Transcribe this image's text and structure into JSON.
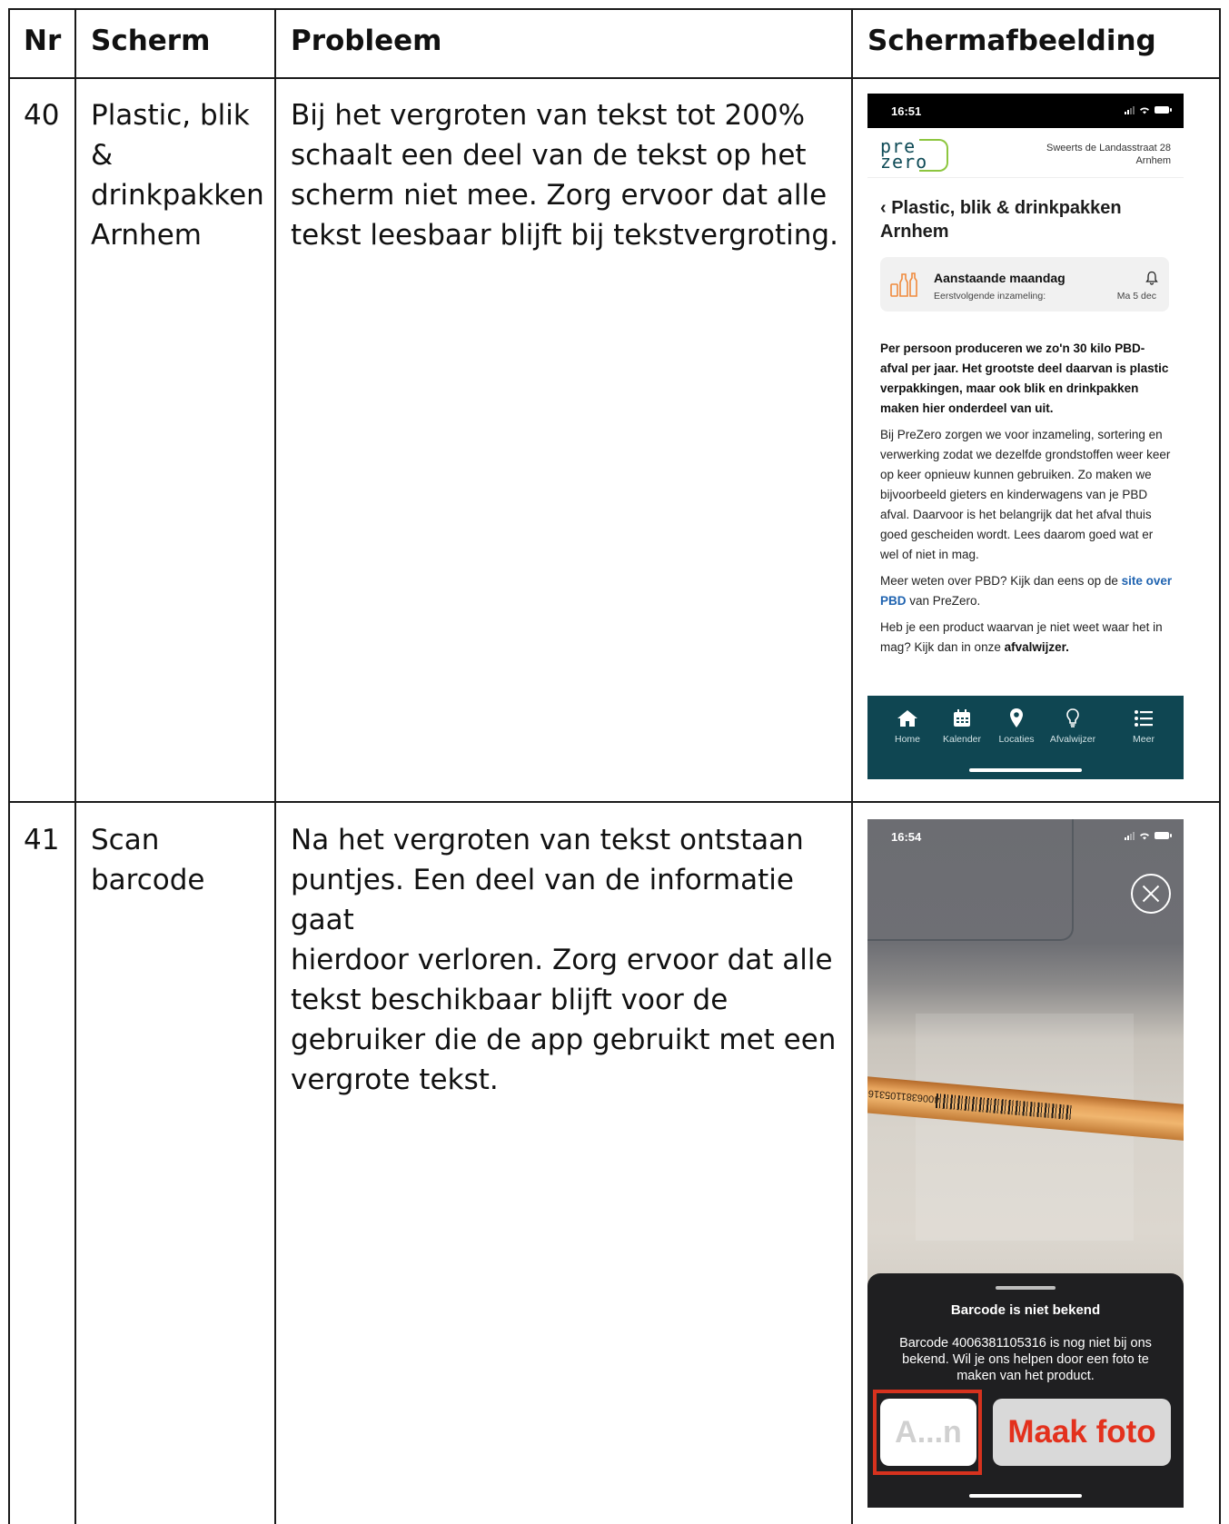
{
  "header": {
    "nr": "Nr",
    "scherm": "Scherm",
    "probleem": "Probleem",
    "schermafbeelding": "Schermafbeelding"
  },
  "rows": [
    {
      "nr": "40",
      "scherm_lines": [
        "Plastic, blik",
        "&",
        "drinkpakken",
        "Arnhem"
      ],
      "probleem_lines": [
        "Bij het vergroten van tekst tot 200%",
        "schaalt een deel van de tekst op het",
        "scherm niet mee. Zorg ervoor dat alle",
        "tekst leesbaar blijft bij tekstvergroting."
      ]
    },
    {
      "nr": "41",
      "scherm_lines": [
        "Scan",
        "barcode"
      ],
      "probleem_lines": [
        "Na het vergroten van tekst ontstaan",
        "puntjes. Een deel van de informatie gaat",
        "hierdoor verloren. Zorg ervoor dat alle",
        "tekst beschikbaar blijft voor de",
        "gebruiker die de app gebruikt met een",
        "vergrote tekst."
      ]
    }
  ],
  "phone1": {
    "time": "16:51",
    "logo_top": "pre",
    "logo_bottom": "zero",
    "address_line1": "Sweerts de Landasstraat 28",
    "address_line2": "Arnhem",
    "title": "‹ Plastic, blik & drinkpakken Arnhem",
    "card_title": "Aanstaande maandag",
    "card_sub": "Eerstvolgende inzameling:",
    "card_date": "Ma 5 dec",
    "lead": "Per persoon produceren we zo'n 30 kilo PBD-afval per jaar. Het grootste deel daarvan is plastic verpakkingen, maar ook blik en drinkpakken maken hier onderdeel van uit.",
    "para1": "Bij PreZero zorgen we voor inzameling, sortering en verwerking zodat we dezelfde grondstoffen weer keer op keer opnieuw kunnen gebruiken. Zo maken we bijvoorbeeld gieters en kinderwagens van je PBD afval. Daarvoor is het belangrijk dat het afval thuis goed gescheiden wordt. Lees daarom goed wat er wel of niet in mag.",
    "para2_pre": "Meer weten over PBD? Kijk dan eens op de ",
    "para2_link": "site over PBD",
    "para2_post": " van PreZero.",
    "para3_pre": "Heb je een product waarvan je niet weet waar het in mag? Kijk dan in onze ",
    "para3_bold": "afvalwijzer.",
    "tabs": [
      "Home",
      "Kalender",
      "Locaties",
      "Afvalwijzer",
      "Meer"
    ]
  },
  "phone2": {
    "time": "16:54",
    "pencil_text": "4006381105316",
    "sheet_title": "Barcode is niet bekend",
    "sheet_msg": "Barcode 4006381105316 is nog niet bij ons bekend. Wil je ons helpen door een foto te maken van het product.",
    "btn_cancel": "A...n",
    "btn_photo": "Maak foto"
  },
  "colors": {
    "tabbar": "#0f4652",
    "highlight": "#d7321e",
    "photo_button_text": "#e3311d",
    "link": "#1f63b0"
  }
}
